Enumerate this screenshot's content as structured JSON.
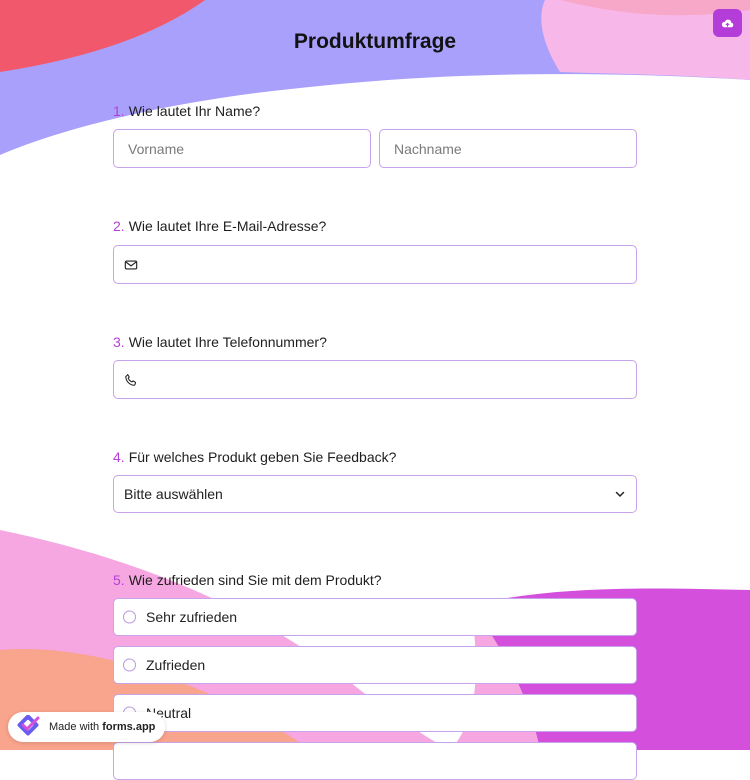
{
  "header": {
    "title": "Produktumfrage"
  },
  "toolbar": {
    "save_icon": "cloud-upload-icon"
  },
  "questions": [
    {
      "number": "1.",
      "label": "Wie lautet Ihr Name?",
      "fields": [
        {
          "placeholder": "Vorname",
          "value": ""
        },
        {
          "placeholder": "Nachname",
          "value": ""
        }
      ]
    },
    {
      "number": "2.",
      "label": "Wie lautet Ihre E-Mail-Adresse?",
      "icon": "mail-icon",
      "value": ""
    },
    {
      "number": "3.",
      "label": "Wie lautet Ihre Telefonnummer?",
      "icon": "phone-icon",
      "value": ""
    },
    {
      "number": "4.",
      "label": "Für welches Produkt geben Sie Feedback?",
      "selected": "Bitte auswählen"
    },
    {
      "number": "5.",
      "label": "Wie zufrieden sind Sie mit dem Produkt?",
      "options": [
        "Sehr zufrieden",
        "Zufrieden",
        "Neutral"
      ]
    }
  ],
  "badge": {
    "prefix": "Made with",
    "brand": "forms.app"
  },
  "colors": {
    "accent": "#b53ed6",
    "border": "#c7a3ea",
    "save_button": "#b43cd8"
  }
}
